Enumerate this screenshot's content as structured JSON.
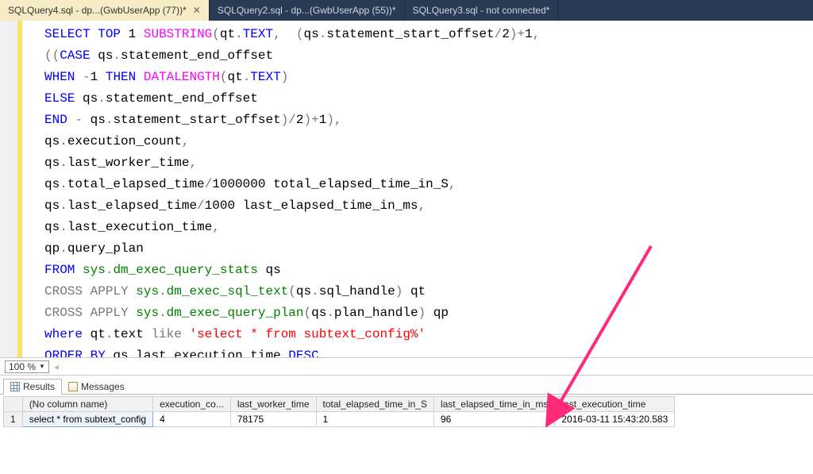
{
  "tabs": [
    {
      "label": "SQLQuery4.sql - dp...(GwbUserApp (77))*",
      "active": true,
      "closeable": true
    },
    {
      "label": "SQLQuery2.sql - dp...(GwbUserApp (55))*",
      "active": false,
      "closeable": false
    },
    {
      "label": "SQLQuery3.sql - not connected*",
      "active": false,
      "closeable": false
    }
  ],
  "sqlTokens": [
    [
      {
        "t": "SELECT",
        "c": "kw"
      },
      {
        "t": " "
      },
      {
        "t": "TOP",
        "c": "kw"
      },
      {
        "t": " "
      },
      {
        "t": "1",
        "c": "num"
      },
      {
        "t": " "
      },
      {
        "t": "SUBSTRING",
        "c": "fn"
      },
      {
        "t": "(",
        "c": "grey"
      },
      {
        "t": "qt"
      },
      {
        "t": ".",
        "c": "grey"
      },
      {
        "t": "TEXT",
        "c": "kw"
      },
      {
        "t": ", ",
        "c": "grey"
      },
      {
        "t": " "
      },
      {
        "t": "(",
        "c": "grey"
      },
      {
        "t": "qs"
      },
      {
        "t": ".",
        "c": "grey"
      },
      {
        "t": "statement_start_offset"
      },
      {
        "t": "/",
        "c": "grey"
      },
      {
        "t": "2",
        "c": "num"
      },
      {
        "t": ")+",
        "c": "grey"
      },
      {
        "t": "1",
        "c": "num"
      },
      {
        "t": ",",
        "c": "grey"
      }
    ],
    [
      {
        "t": "((",
        "c": "grey"
      },
      {
        "t": "CASE",
        "c": "kw"
      },
      {
        "t": " qs"
      },
      {
        "t": ".",
        "c": "grey"
      },
      {
        "t": "statement_end_offset"
      }
    ],
    [
      {
        "t": "WHEN",
        "c": "kw"
      },
      {
        "t": " "
      },
      {
        "t": "-",
        "c": "grey"
      },
      {
        "t": "1",
        "c": "num"
      },
      {
        "t": " "
      },
      {
        "t": "THEN",
        "c": "kw"
      },
      {
        "t": " "
      },
      {
        "t": "DATALENGTH",
        "c": "fn"
      },
      {
        "t": "(",
        "c": "grey"
      },
      {
        "t": "qt"
      },
      {
        "t": ".",
        "c": "grey"
      },
      {
        "t": "TEXT",
        "c": "kw"
      },
      {
        "t": ")",
        "c": "grey"
      }
    ],
    [
      {
        "t": "ELSE",
        "c": "kw"
      },
      {
        "t": " qs"
      },
      {
        "t": ".",
        "c": "grey"
      },
      {
        "t": "statement_end_offset"
      }
    ],
    [
      {
        "t": "END",
        "c": "kw"
      },
      {
        "t": " "
      },
      {
        "t": "-",
        "c": "grey"
      },
      {
        "t": " qs"
      },
      {
        "t": ".",
        "c": "grey"
      },
      {
        "t": "statement_start_offset"
      },
      {
        "t": ")/",
        "c": "grey"
      },
      {
        "t": "2",
        "c": "num"
      },
      {
        "t": ")+",
        "c": "grey"
      },
      {
        "t": "1",
        "c": "num"
      },
      {
        "t": "),",
        "c": "grey"
      }
    ],
    [
      {
        "t": "qs"
      },
      {
        "t": ".",
        "c": "grey"
      },
      {
        "t": "execution_count"
      },
      {
        "t": ",",
        "c": "grey"
      }
    ],
    [
      {
        "t": "qs"
      },
      {
        "t": ".",
        "c": "grey"
      },
      {
        "t": "last_worker_time"
      },
      {
        "t": ",",
        "c": "grey"
      }
    ],
    [
      {
        "t": "qs"
      },
      {
        "t": ".",
        "c": "grey"
      },
      {
        "t": "total_elapsed_time"
      },
      {
        "t": "/",
        "c": "grey"
      },
      {
        "t": "1000000",
        "c": "num"
      },
      {
        "t": " total_elapsed_time_in_S"
      },
      {
        "t": ",",
        "c": "grey"
      }
    ],
    [
      {
        "t": "qs"
      },
      {
        "t": ".",
        "c": "grey"
      },
      {
        "t": "last_elapsed_time"
      },
      {
        "t": "/",
        "c": "grey"
      },
      {
        "t": "1000",
        "c": "num"
      },
      {
        "t": " last_elapsed_time_in_ms"
      },
      {
        "t": ",",
        "c": "grey"
      }
    ],
    [
      {
        "t": "qs"
      },
      {
        "t": ".",
        "c": "grey"
      },
      {
        "t": "last_execution_time"
      },
      {
        "t": ",",
        "c": "grey"
      }
    ],
    [
      {
        "t": "qp"
      },
      {
        "t": ".",
        "c": "grey"
      },
      {
        "t": "query_plan"
      }
    ],
    [
      {
        "t": "FROM",
        "c": "kw"
      },
      {
        "t": " "
      },
      {
        "t": "sys",
        "c": "sys"
      },
      {
        "t": ".",
        "c": "grey"
      },
      {
        "t": "dm_exec_query_stats",
        "c": "sys"
      },
      {
        "t": " qs"
      }
    ],
    [
      {
        "t": "CROSS",
        "c": "grey"
      },
      {
        "t": " "
      },
      {
        "t": "APPLY",
        "c": "grey"
      },
      {
        "t": " "
      },
      {
        "t": "sys",
        "c": "sys"
      },
      {
        "t": ".",
        "c": "grey"
      },
      {
        "t": "dm_exec_sql_text",
        "c": "sys"
      },
      {
        "t": "(",
        "c": "grey"
      },
      {
        "t": "qs"
      },
      {
        "t": ".",
        "c": "grey"
      },
      {
        "t": "sql_handle"
      },
      {
        "t": ")",
        "c": "grey"
      },
      {
        "t": " qt"
      }
    ],
    [
      {
        "t": "CROSS",
        "c": "grey"
      },
      {
        "t": " "
      },
      {
        "t": "APPLY",
        "c": "grey"
      },
      {
        "t": " "
      },
      {
        "t": "sys",
        "c": "sys"
      },
      {
        "t": ".",
        "c": "grey"
      },
      {
        "t": "dm_exec_query_plan",
        "c": "sys"
      },
      {
        "t": "(",
        "c": "grey"
      },
      {
        "t": "qs"
      },
      {
        "t": ".",
        "c": "grey"
      },
      {
        "t": "plan_handle"
      },
      {
        "t": ")",
        "c": "grey"
      },
      {
        "t": " qp"
      }
    ],
    [
      {
        "t": "where",
        "c": "kw"
      },
      {
        "t": " qt"
      },
      {
        "t": ".",
        "c": "grey"
      },
      {
        "t": "text"
      },
      {
        "t": " "
      },
      {
        "t": "like",
        "c": "grey"
      },
      {
        "t": " "
      },
      {
        "t": "'select * from subtext_config%'",
        "c": "str"
      }
    ],
    [
      {
        "t": "ORDER",
        "c": "kw"
      },
      {
        "t": " "
      },
      {
        "t": "BY",
        "c": "kw"
      },
      {
        "t": " qs"
      },
      {
        "t": ".",
        "c": "grey"
      },
      {
        "t": "last_execution_time"
      },
      {
        "t": " "
      },
      {
        "t": "DESC",
        "c": "kw"
      }
    ]
  ],
  "zoom": {
    "value": "100 %"
  },
  "panes": {
    "results": "Results",
    "messages": "Messages"
  },
  "grid": {
    "headers": [
      "(No column name)",
      "execution_co...",
      "last_worker_time",
      "total_elapsed_time_in_S",
      "last_elapsed_time_in_ms",
      "last_execution_time"
    ],
    "rows": [
      {
        "n": "1",
        "cells": [
          "select * from subtext_config",
          "4",
          "78175",
          "1",
          "96",
          "2016-03-11 15:43:20.583"
        ]
      }
    ]
  }
}
